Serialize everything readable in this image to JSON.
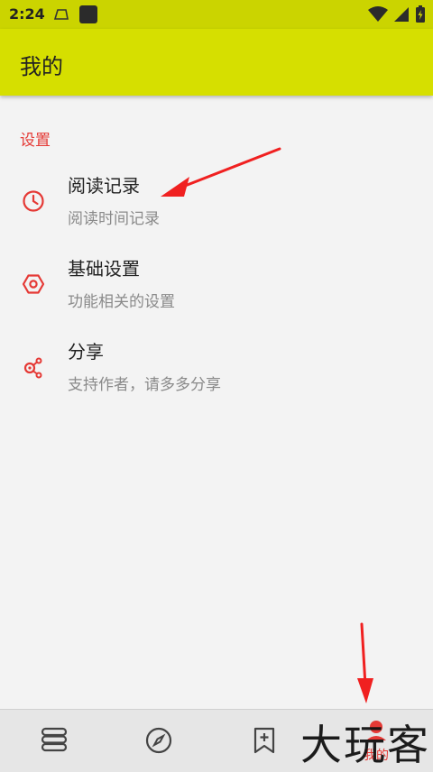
{
  "status_bar": {
    "time": "2:24"
  },
  "app_bar": {
    "title": "我的"
  },
  "settings": {
    "section_title": "设置",
    "items": [
      {
        "title": "阅读记录",
        "subtitle": "阅读时间记录",
        "icon": "clock-icon"
      },
      {
        "title": "基础设置",
        "subtitle": "功能相关的设置",
        "icon": "hexagon-settings-icon"
      },
      {
        "title": "分享",
        "subtitle": "支持作者，请多多分享",
        "icon": "share-icon"
      }
    ]
  },
  "bottom_nav": {
    "tabs": [
      {
        "id": "bookshelf",
        "icon": "bookshelf-icon"
      },
      {
        "id": "discover",
        "icon": "compass-icon"
      },
      {
        "id": "bookmark",
        "icon": "bookmark-add-icon"
      },
      {
        "id": "mine",
        "label": "我的",
        "icon": "person-icon",
        "active": true
      }
    ]
  },
  "watermark": {
    "text": "大玩客"
  },
  "colors": {
    "status_bar": "#cbd400",
    "app_bar": "#d6df00",
    "accent": "#e53935",
    "background": "#f3f3f3"
  }
}
